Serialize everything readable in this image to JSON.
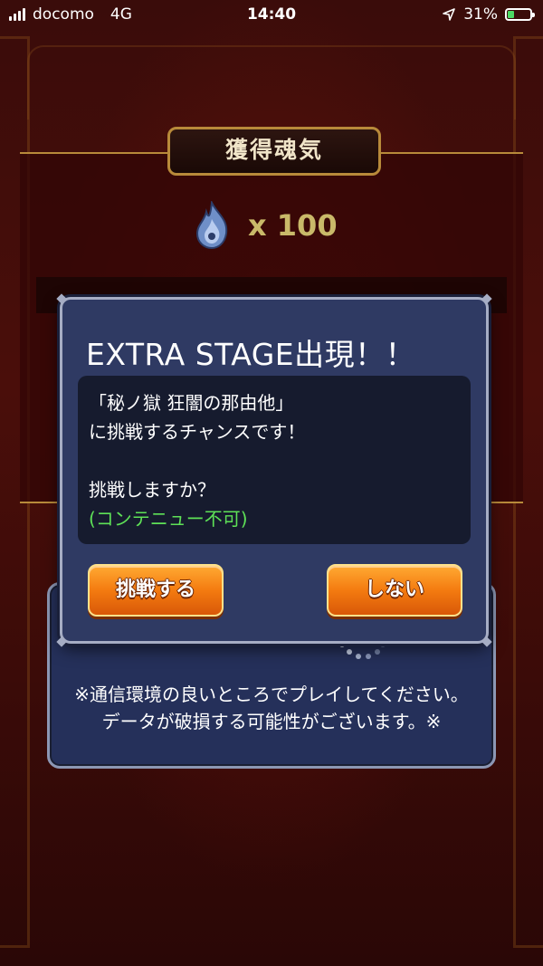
{
  "status_bar": {
    "carrier": "docomo",
    "network": "4G",
    "time": "14:40",
    "battery_percent": "31%",
    "battery_level": 0.31,
    "signal_bars": 4,
    "icons": [
      "signal-icon",
      "location-arrow-icon",
      "battery-icon"
    ]
  },
  "result": {
    "header": "獲得魂気",
    "soul_icon": "soul-flame-icon",
    "soul_amount": "x 100"
  },
  "dialog": {
    "title": "EXTRA STAGE出現！！",
    "message_line1": "「秘ノ獄 狂闇の那由他」",
    "message_line2": "に挑戦するチャンスです！",
    "question": "挑戦しますか？",
    "note": "(コンテニュー不可)",
    "challenge_button": "挑戦する",
    "decline_button": "しない"
  },
  "connection": {
    "note_line1": "※通信環境の良いところでプレイしてください。",
    "note_line2": "データが破損する可能性がございます。※"
  },
  "colors": {
    "dialog_bg": "#2f3a63",
    "button_orange": "#f47b10",
    "note_green": "#5ee157",
    "gold_border": "#b88a3a"
  }
}
